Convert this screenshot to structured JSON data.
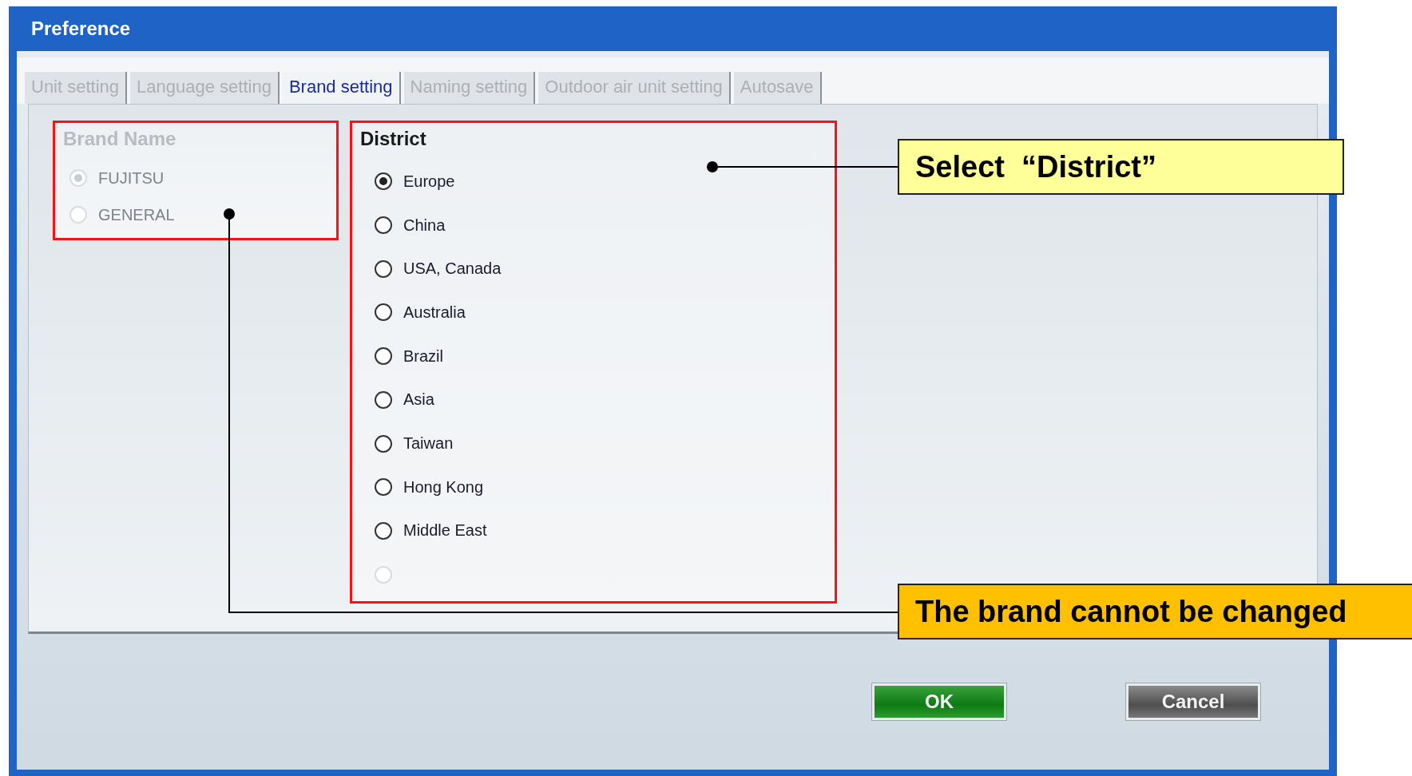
{
  "window": {
    "title": "Preference"
  },
  "tabs": [
    {
      "label": "Unit setting",
      "selected": false
    },
    {
      "label": "Language setting",
      "selected": false
    },
    {
      "label": "Brand setting",
      "selected": true
    },
    {
      "label": "Naming setting",
      "selected": false
    },
    {
      "label": "Outdoor air unit setting",
      "selected": false
    },
    {
      "label": "Autosave",
      "selected": false
    }
  ],
  "brand_group": {
    "title": "Brand Name",
    "disabled": true,
    "options": [
      {
        "label": "FUJITSU",
        "selected": true
      },
      {
        "label": "GENERAL",
        "selected": false
      }
    ]
  },
  "district_group": {
    "title": "District",
    "options": [
      {
        "label": "Europe",
        "selected": true,
        "disabled": false
      },
      {
        "label": "China",
        "selected": false,
        "disabled": false
      },
      {
        "label": "USA, Canada",
        "selected": false,
        "disabled": false
      },
      {
        "label": "Australia",
        "selected": false,
        "disabled": false
      },
      {
        "label": "Brazil",
        "selected": false,
        "disabled": false
      },
      {
        "label": "Asia",
        "selected": false,
        "disabled": false
      },
      {
        "label": "Taiwan",
        "selected": false,
        "disabled": false
      },
      {
        "label": "Hong Kong",
        "selected": false,
        "disabled": false
      },
      {
        "label": "Middle East",
        "selected": false,
        "disabled": false
      },
      {
        "selected": false,
        "disabled": true
      }
    ]
  },
  "buttons": [
    {
      "label": "OK",
      "kind": "primary"
    },
    {
      "label": "Cancel",
      "kind": "secondary"
    }
  ],
  "callouts": [
    {
      "text": "Select  “District”",
      "color": "#ffff99"
    },
    {
      "text": "The brand cannot be changed",
      "color": "#ffc000"
    }
  ]
}
